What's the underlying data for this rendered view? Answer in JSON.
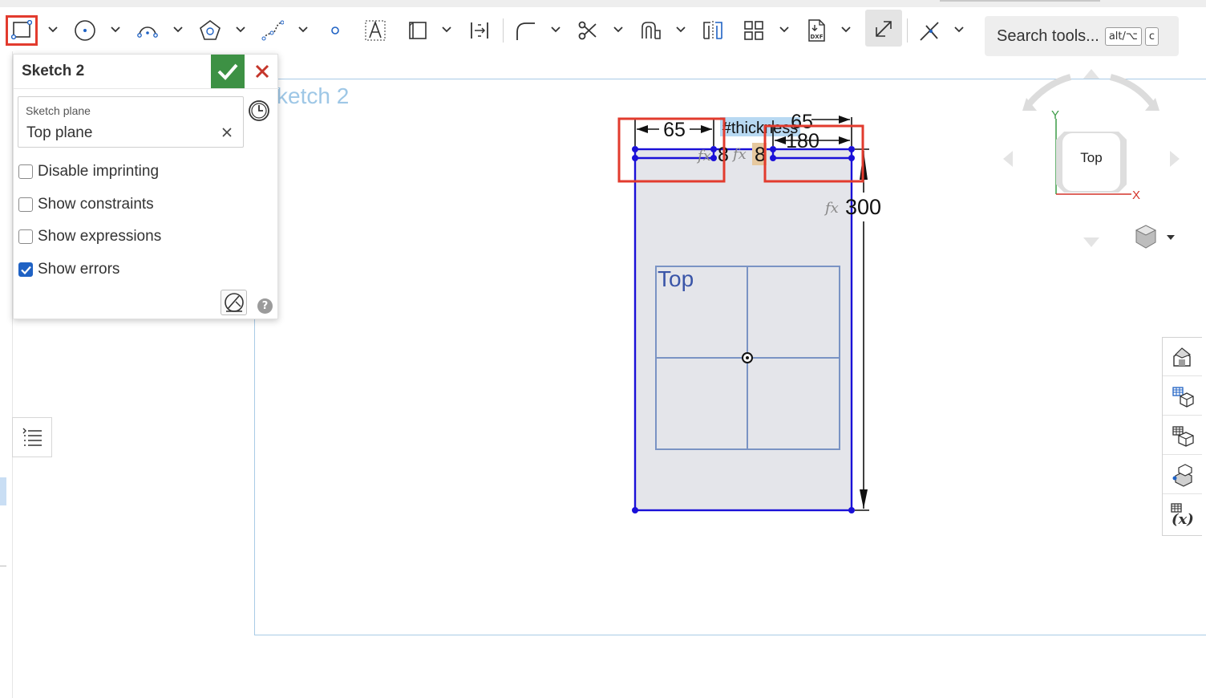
{
  "toolbar": {
    "tools": [
      {
        "name": "rectangle-tool",
        "icon": "rectangle-icon",
        "active": true
      },
      {
        "name": "circle-tool",
        "icon": "circle-icon"
      },
      {
        "name": "arc-tool",
        "icon": "arc-icon"
      },
      {
        "name": "polygon-tool",
        "icon": "polygon-icon"
      },
      {
        "name": "spline-tool",
        "icon": "spline-icon"
      },
      {
        "name": "point-tool",
        "icon": "point-icon"
      },
      {
        "name": "text-tool",
        "icon": "text-icon"
      },
      {
        "name": "construction-tool",
        "icon": "construction-icon"
      },
      {
        "name": "dimension-tool",
        "icon": "dimension-icon"
      },
      {
        "name": "fillet-tool",
        "icon": "fillet-icon"
      },
      {
        "name": "trim-tool",
        "icon": "trim-icon"
      },
      {
        "name": "offset-tool",
        "icon": "offset-icon"
      },
      {
        "name": "mirror-tool",
        "icon": "mirror-icon"
      },
      {
        "name": "pattern-tool",
        "icon": "pattern-icon"
      },
      {
        "name": "dxf-import-tool",
        "icon": "dxf-icon"
      },
      {
        "name": "tangent-tool",
        "icon": "tangent-icon",
        "pressed": true
      },
      {
        "name": "constraint-tool",
        "icon": "constraint-icon"
      }
    ],
    "dxf_badge": "DXF",
    "search": {
      "label": "Search tools...",
      "key1": "alt/⌥",
      "key2": "c"
    }
  },
  "dialog": {
    "title": "Sketch 2",
    "plane_label": "Sketch plane",
    "plane_value": "Top plane",
    "options": [
      {
        "label": "Disable imprinting",
        "checked": false
      },
      {
        "label": "Show constraints",
        "checked": false
      },
      {
        "label": "Show expressions",
        "checked": false
      },
      {
        "label": "Show errors",
        "checked": true
      }
    ]
  },
  "canvas": {
    "sketch_label": "ketch 2",
    "plane_name": "Top",
    "dims": {
      "left_width": "65",
      "right_width": "65",
      "right_width_overlap": "180",
      "thickness_tag": "#thickness",
      "left_thick": "8",
      "right_thick": "8",
      "height": "300",
      "fx": "fx"
    }
  },
  "viewcube": {
    "face": "Top",
    "axis_x": "X",
    "axis_y": "Y"
  },
  "colors": {
    "accent": "#1a10d8",
    "highlight": "#e23b2e",
    "confirm": "#3d9144",
    "sheet_border": "#a9cbe6"
  }
}
